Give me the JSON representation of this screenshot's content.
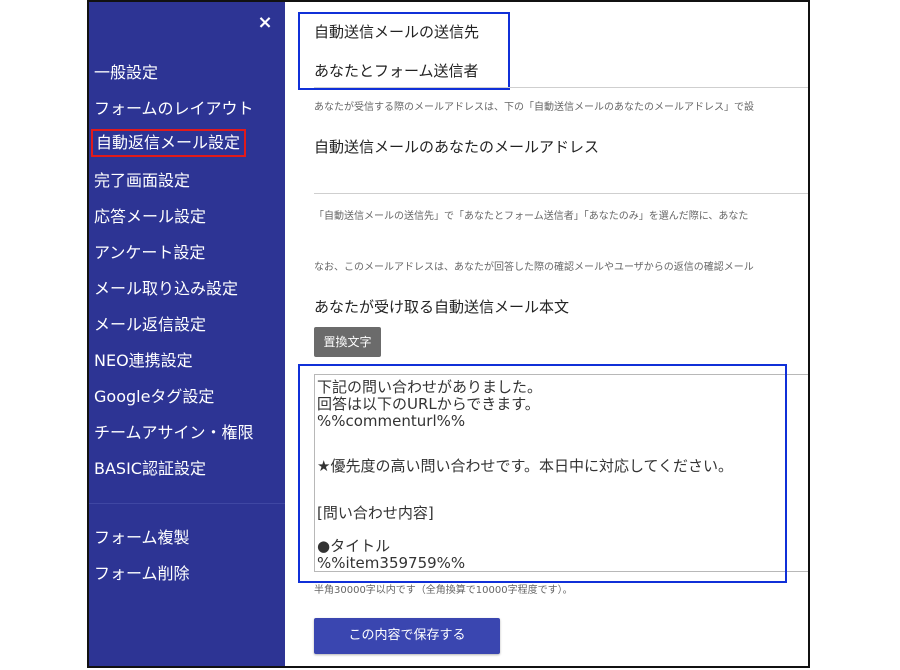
{
  "sidebar": {
    "close_label": "×",
    "items": [
      {
        "label": "一般設定"
      },
      {
        "label": "フォームのレイアウト"
      },
      {
        "label": "自動返信メール設定"
      },
      {
        "label": "完了画面設定"
      },
      {
        "label": "応答メール設定"
      },
      {
        "label": "アンケート設定"
      },
      {
        "label": "メール取り込み設定"
      },
      {
        "label": "メール返信設定"
      },
      {
        "label": "NEO連携設定"
      },
      {
        "label": "Googleタグ設定"
      },
      {
        "label": "チームアサイン・権限"
      },
      {
        "label": "BASIC認証設定"
      }
    ],
    "bottom_items": [
      {
        "label": "フォーム複製"
      },
      {
        "label": "フォーム削除"
      }
    ]
  },
  "main": {
    "recipient_label": "自動送信メールの送信先",
    "recipient_value": "あなたとフォーム送信者",
    "recipient_hint": "あなたが受信する際のメールアドレスは、下の「自動送信メールのあなたのメールアドレス」で設",
    "address_label": "自動送信メールのあなたのメールアドレス",
    "address_value": "",
    "address_hint1": "「自動送信メールの送信先」で「あなたとフォーム送信者」「あなたのみ」を選んだ際に、あなた",
    "address_hint2": "なお、このメールアドレスは、あなたが回答した際の確認メールやユーザからの返信の確認メール",
    "body_label": "あなたが受け取る自動送信メール本文",
    "placeholder_button": "置換文字",
    "body_lines": [
      "下記の問い合わせがありました。",
      "回答は以下のURLからできます。",
      "%%commenturl%%",
      "",
      "★優先度の高い問い合わせです。本日中に対応してください。",
      "",
      "[問い合わせ内容]",
      "",
      "●タイトル",
      "%%item359759%%"
    ],
    "char_limit_hint": "半角30000字以内です（全角換算で10000字程度です）。",
    "save_button": "この内容で保存する"
  },
  "colors": {
    "sidebar_bg": "#2d3494",
    "highlight_red": "#e21a1a",
    "highlight_blue": "#1030d8",
    "save_button_bg": "#3a46b0",
    "placeholder_button_bg": "#6b6b6b"
  }
}
